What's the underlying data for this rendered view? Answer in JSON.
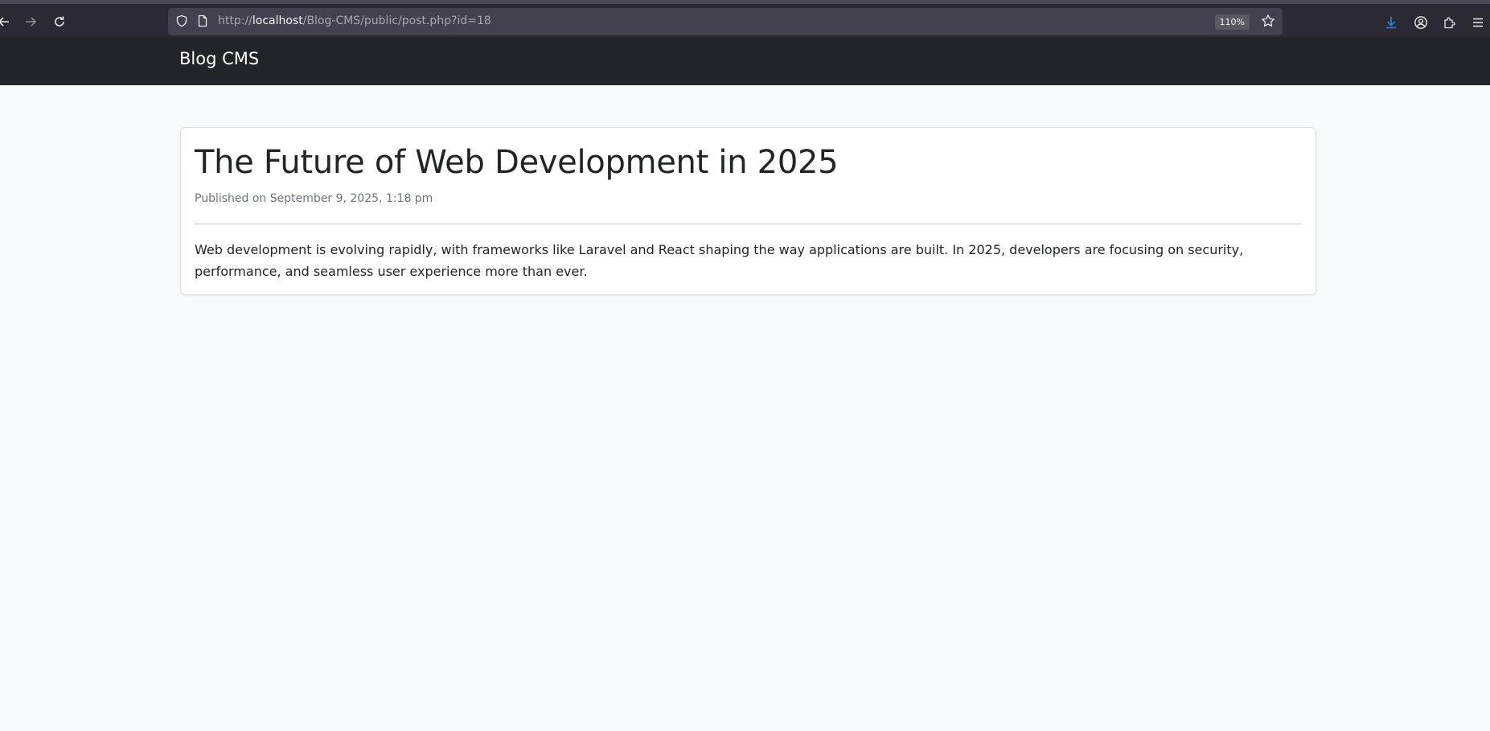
{
  "browser": {
    "url_prefix": "http://",
    "url_host": "localhost",
    "url_path": "/Blog-CMS/public/post.php?id=18",
    "zoom": "110%"
  },
  "navbar": {
    "brand": "Blog CMS"
  },
  "post": {
    "title": "The Future of Web Development in 2025",
    "published": "Published on September 9, 2025, 1:18 pm",
    "body": "Web development is evolving rapidly, with frameworks like Laravel and React shaping the way applications are built. In 2025, developers are focusing on security, performance, and seamless user experience more than ever."
  },
  "icons": {
    "back": "arrow-left-icon",
    "forward": "arrow-right-icon",
    "reload": "reload-icon",
    "shield": "shield-icon",
    "page": "page-icon",
    "bookmark": "star-icon",
    "download": "download-icon",
    "account": "account-icon",
    "extensions": "puzzle-icon",
    "menu": "hamburger-menu-icon"
  },
  "colors": {
    "navbar_bg": "#212529",
    "page_bg": "#f8f9fa",
    "download_accent": "#2f7de1"
  }
}
